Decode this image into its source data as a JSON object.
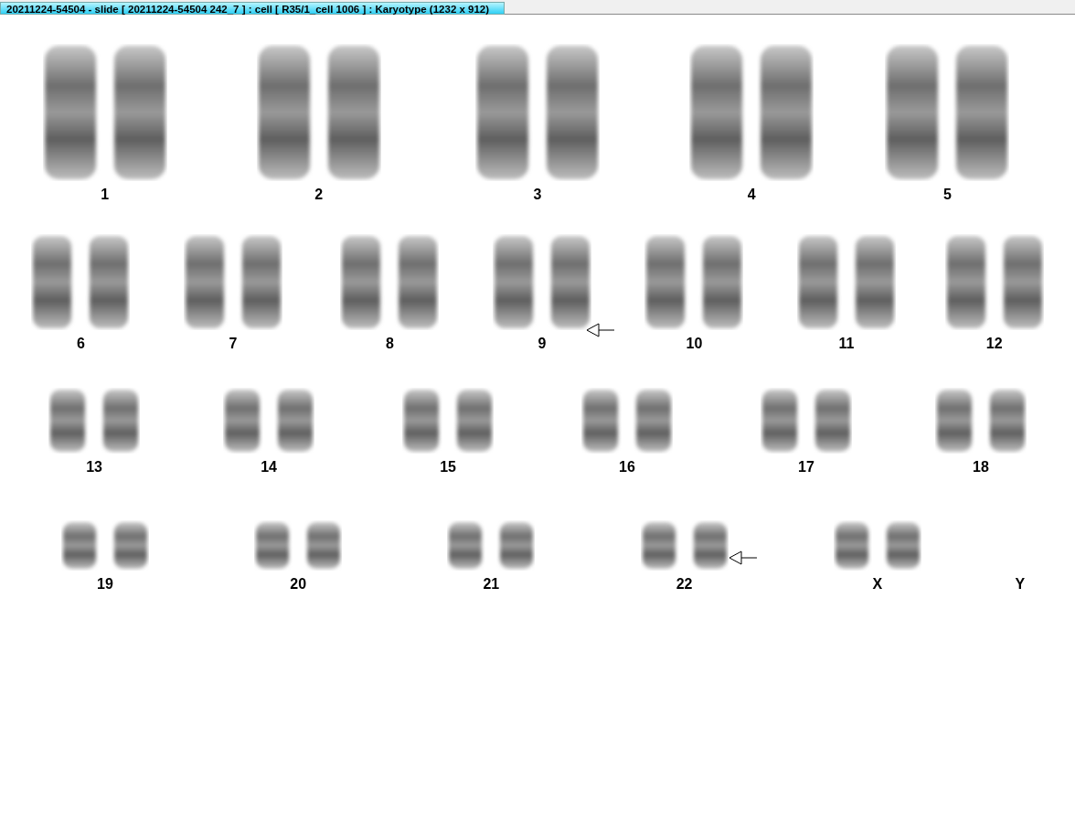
{
  "window": {
    "title": "20211224-54504 - slide [ 20211224-54504 242_7 ] : cell [ R35/1_cell 1006 ] : Karyotype  (1232 x 912)"
  },
  "rows": [
    {
      "pairs": [
        {
          "label": "1",
          "kind": "pair",
          "marked": false
        },
        {
          "label": "2",
          "kind": "pair",
          "marked": false
        },
        {
          "label": "3",
          "kind": "pair",
          "marked": false
        },
        {
          "label": "4",
          "kind": "pair",
          "marked": false
        },
        {
          "label": "5",
          "kind": "pair",
          "marked": false
        }
      ]
    },
    {
      "pairs": [
        {
          "label": "6",
          "kind": "pair",
          "marked": false
        },
        {
          "label": "7",
          "kind": "pair",
          "marked": false
        },
        {
          "label": "8",
          "kind": "pair",
          "marked": false
        },
        {
          "label": "9",
          "kind": "pair",
          "marked": true
        },
        {
          "label": "10",
          "kind": "pair",
          "marked": false
        },
        {
          "label": "11",
          "kind": "pair",
          "marked": false
        },
        {
          "label": "12",
          "kind": "pair",
          "marked": false
        }
      ]
    },
    {
      "pairs": [
        {
          "label": "13",
          "kind": "pair",
          "marked": false
        },
        {
          "label": "14",
          "kind": "pair",
          "marked": false
        },
        {
          "label": "15",
          "kind": "pair",
          "marked": false
        },
        {
          "label": "16",
          "kind": "pair",
          "marked": false
        },
        {
          "label": "17",
          "kind": "pair",
          "marked": false
        },
        {
          "label": "18",
          "kind": "pair",
          "marked": false
        }
      ]
    },
    {
      "pairs": [
        {
          "label": "19",
          "kind": "pair",
          "marked": false
        },
        {
          "label": "20",
          "kind": "pair",
          "marked": false
        },
        {
          "label": "21",
          "kind": "pair",
          "marked": false
        },
        {
          "label": "22",
          "kind": "pair",
          "marked": true
        },
        {
          "label": "X",
          "kind": "pair",
          "marked": false
        },
        {
          "label": "Y",
          "kind": "empty",
          "marked": false
        }
      ]
    }
  ]
}
